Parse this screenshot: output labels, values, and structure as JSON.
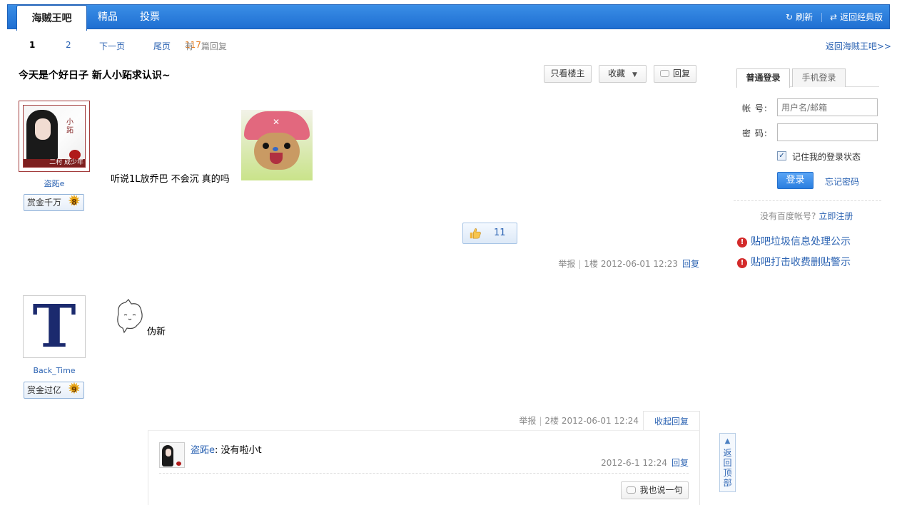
{
  "nav": {
    "main_tab": "海贼王吧",
    "tabs": [
      "精品",
      "投票"
    ],
    "refresh": "刷新",
    "classic": "返回经典版"
  },
  "pager": {
    "pages": [
      "1",
      "2"
    ],
    "next": "下一页",
    "last": "尾页",
    "count_prefix": "有",
    "count": "117",
    "count_suffix": "篇回复"
  },
  "back_to_bar": "返回海贼王吧>>",
  "thread": {
    "title": "今天是个好日子  新人小跖求认识~",
    "only_op": "只看楼主",
    "favorite": "收藏",
    "reply": "回复"
  },
  "posts": [
    {
      "username": "盗跖e",
      "badge": "赏金千万",
      "level": "8",
      "avatar_text_v": "小跖",
      "avatar_band": "二村 成少年",
      "content": "听说1L放乔巴  不会沉  真的吗",
      "likes": "11",
      "report": "举报",
      "floor": "1楼",
      "time": "2012-06-01 12:23",
      "reply": "回复"
    },
    {
      "username": "Back_Time",
      "badge": "赏金过亿",
      "level": "9",
      "avatar_letter": "T",
      "content": "伪新",
      "report": "举报",
      "floor": "2楼",
      "time": "2012-06-01 12:24",
      "collapse": "收起回复",
      "sub_reply": {
        "name": "盗跖e",
        "text": "没有啦小t",
        "time": "2012-6-1 12:24",
        "reply": "回复",
        "say": "我也说一句"
      }
    }
  ],
  "back_top": "返回顶部",
  "login": {
    "tab_normal": "普通登录",
    "tab_mobile": "手机登录",
    "account_label": "帐  号:",
    "account_placeholder": "用户名/邮箱",
    "password_label": "密  码:",
    "remember": "记住我的登录状态",
    "submit": "登录",
    "forgot": "忘记密码",
    "no_account": "没有百度帐号?",
    "register": "立即注册"
  },
  "notices": [
    "贴吧垃圾信息处理公示",
    "贴吧打击收费删贴警示"
  ]
}
